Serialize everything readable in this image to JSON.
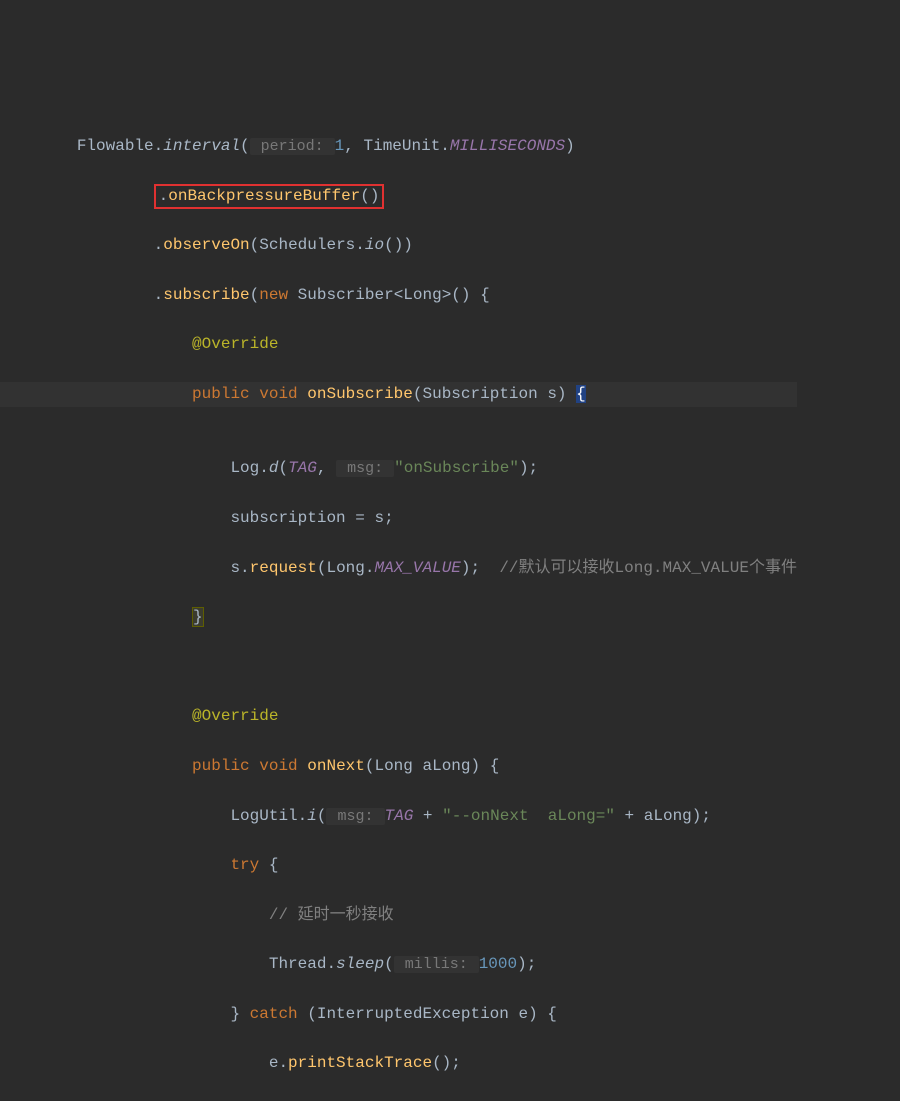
{
  "code": {
    "l1": {
      "cls": "Flowable",
      "dot": ".",
      "interval": "interval",
      "op": "(",
      "hint_period": " period: ",
      "one": "1",
      "comma": ", ",
      "timeunit": "TimeUnit",
      "ms": "MILLISECONDS",
      "cp": ")"
    },
    "l2": {
      "dot": ".",
      "onbp": "onBackpressureBuffer",
      "parens": "()"
    },
    "l3": {
      "dot": ".",
      "observe": "observeOn",
      "op": "(",
      "sched": "Schedulers",
      "io": "io",
      "parens": "()",
      "cp": ")"
    },
    "l4": {
      "dot": ".",
      "subscribe": "subscribe",
      "op": "(",
      "new": "new ",
      "sub": "Subscriber<Long>() {"
    },
    "l5": {
      "annot": "@Override"
    },
    "l6": {
      "pub": "public ",
      "void": "void ",
      "onsub": "onSubscribe",
      "op": "(",
      "subtype": "Subscription s",
      "cp": ") ",
      "brace": "{"
    },
    "l8": {
      "log": "Log",
      "dot": ".",
      "d": "d",
      "op": "(",
      "tag": "TAG",
      "comma": ", ",
      "hint_msg": " msg: ",
      "str": "\"onSubscribe\"",
      "cp": ");"
    },
    "l9": {
      "txt": "subscription = s;"
    },
    "l10": {
      "s": "s.",
      "req": "request",
      "op": "(",
      "long": "Long",
      "dot": ".",
      "max": "MAX_VALUE",
      "cp": ");  ",
      "comment": "//默认可以接收Long.MAX_VALUE个事件"
    },
    "l11": {
      "brace": "}"
    },
    "l13": {
      "annot": "@Override"
    },
    "l14": {
      "pub": "public ",
      "void": "void ",
      "onnext": "onNext",
      "op": "(Long aLong) {"
    },
    "l15": {
      "logutil": "LogUtil",
      "dot": ".",
      "i": "i",
      "op": "(",
      "hint_msg": " msg: ",
      "tag": "TAG",
      "plus1": " + ",
      "str": "\"--onNext  aLong=\"",
      "plus2": " + aLong);"
    },
    "l16": {
      "try": "try ",
      "brace": "{"
    },
    "l17": {
      "comment": "// 延时一秒接收"
    },
    "l18": {
      "thread": "Thread",
      "dot": ".",
      "sleep": "sleep",
      "op": "(",
      "hint": " millis: ",
      "num": "1000",
      "cp": ");"
    },
    "l19": {
      "cb": "} ",
      "catch": "catch ",
      "op": "(InterruptedException e) {"
    },
    "l20": {
      "txt": "e.",
      "pst": "printStackTrace",
      "parens": "();"
    }
  }
}
